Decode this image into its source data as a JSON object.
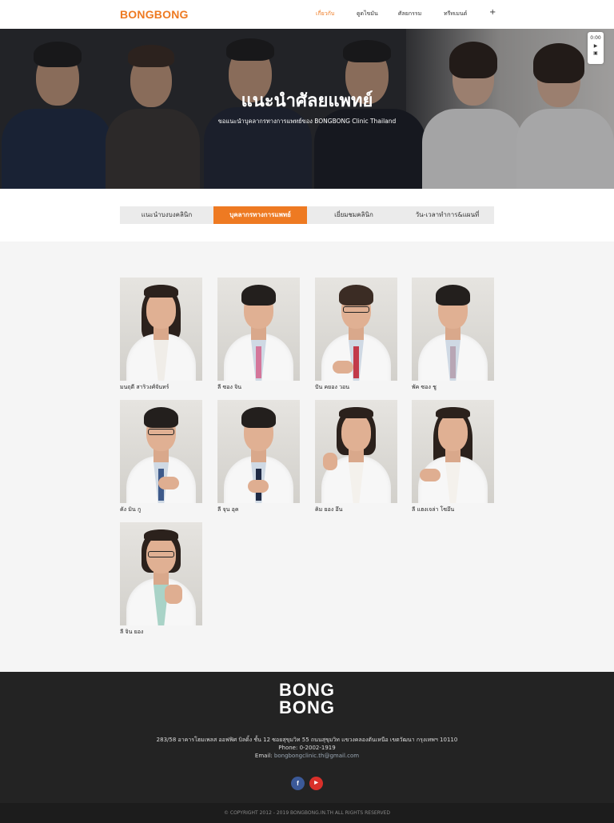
{
  "header": {
    "logo": "BONGBONG",
    "nav": [
      "เกี่ยวกับ",
      "ดูดไขมัน",
      "ศัลยกรรม",
      "ทรีทเมนต์",
      "+"
    ]
  },
  "hero": {
    "title": "แนะนำศัลยแพทย์",
    "subtitle": "ขอแนะนำบุคลากรทางการแพทย์ของ BONGBONG Clinic Thailand"
  },
  "widget": {
    "time": "0:00",
    "play_icon": "▶",
    "bookmark_icon": "🔖"
  },
  "tabs": [
    {
      "label": "แนะนำบงบงคลินิก",
      "active": false
    },
    {
      "label": "บุคลากรทางการแพทย์",
      "active": true
    },
    {
      "label": "เยี่ยมชมคลินิก",
      "active": false
    },
    {
      "label": "วัน-เวลาทำการ&แผนที่",
      "active": false
    }
  ],
  "doctors": [
    {
      "name": "มนฤดี สาริวงศ์จันทร์"
    },
    {
      "name": "ลี ซอง จิน"
    },
    {
      "name": "ปัน คยอง วอน"
    },
    {
      "name": "พัค ซอง ชู"
    },
    {
      "name": "คัง มิน กู"
    },
    {
      "name": "ลี จุน อุค"
    },
    {
      "name": "คิม ยอง อึน"
    },
    {
      "name": "ลี แฮงเจล่า โซอึน"
    },
    {
      "name": "ลี จิน ยอง"
    }
  ],
  "footer": {
    "logo_line1": "BONG",
    "logo_line2": "BONG",
    "address": "283/58 อาคารโฮมเพลส ออฟฟิศ บิลดิ้ง ชั้น 12 ซอยสุขุมวิท 55 ถนนสุขุมวิท แขวงคลองตันเหนือ เขตวัฒนา กรุงเทพฯ 10110",
    "phone": "Phone: 0-2002-1919",
    "email_label": "Email:",
    "email": "bongbongclinic.th@gmail.com",
    "socials": [
      "f",
      "▶"
    ],
    "copyright": "© COPYRIGHT 2012 - 2019 BONGBONG.IN.TH ALL RIGHTS RESERVED"
  },
  "colors": {
    "accent": "#ee7a22",
    "footer_bg": "#232323",
    "tab_bg": "#ebebeb",
    "section_bg": "#f5f5f5"
  }
}
